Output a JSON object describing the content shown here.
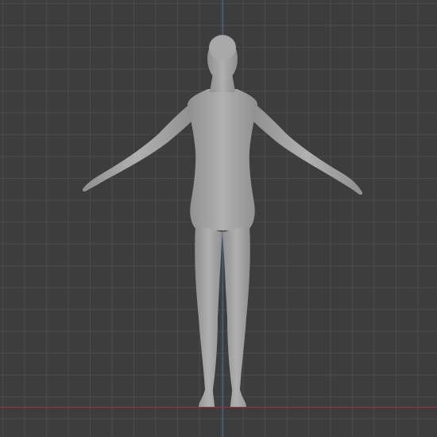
{
  "viewport": {
    "background": "#3d3d3d",
    "grid_color": "#4a4a4a",
    "axis_x_color": "#8a3a44",
    "axis_z_color": "#4a6e9a"
  },
  "model": {
    "icon": "humanoid-base-mesh",
    "fill": "#a3a3a3",
    "shade": "#8c8c8c",
    "pose": "A-pose"
  }
}
